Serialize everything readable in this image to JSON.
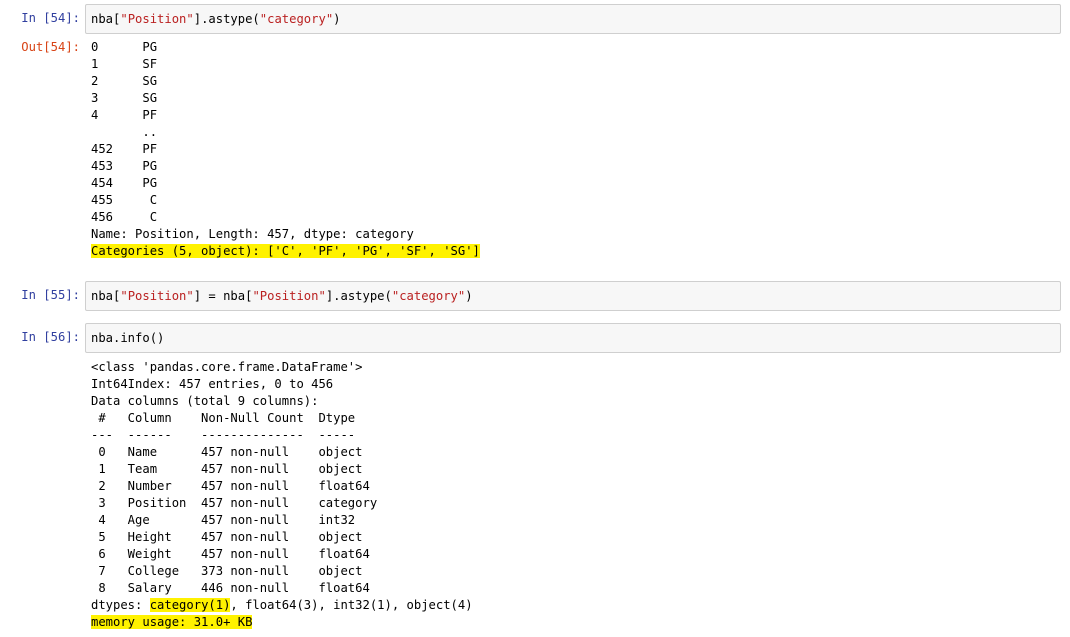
{
  "cells": [
    {
      "in_prompt": "In [54]:",
      "code": {
        "a": "nba[",
        "b": "\"Position\"",
        "c": "].astype(",
        "d": "\"category\"",
        "e": ")"
      },
      "out_prompt": "Out[54]:",
      "output_lines": [
        "0      PG",
        "1      SF",
        "2      SG",
        "3      SG",
        "4      PF",
        "       ..",
        "452    PF",
        "453    PG",
        "454    PG",
        "455     C",
        "456     C",
        "Name: Position, Length: 457, dtype: category",
        "Categories (5, object): ['C', 'PF', 'PG', 'SF', 'SG']"
      ]
    },
    {
      "in_prompt": "In [55]:",
      "code": {
        "a": "nba[",
        "b": "\"Position\"",
        "c": "] = nba[",
        "d": "\"Position\"",
        "e": "].astype(",
        "f": "\"category\"",
        "g": ")"
      }
    },
    {
      "in_prompt": "In [56]:",
      "code": {
        "a": "nba.info()"
      },
      "output_lines": [
        "<class 'pandas.core.frame.DataFrame'>",
        "Int64Index: 457 entries, 0 to 456",
        "Data columns (total 9 columns):",
        " #   Column    Non-Null Count  Dtype   ",
        "---  ------    --------------  -----   ",
        " 0   Name      457 non-null    object  ",
        " 1   Team      457 non-null    object  ",
        " 2   Number    457 non-null    float64 ",
        " 3   Position  457 non-null    category",
        " 4   Age       457 non-null    int32   ",
        " 5   Height    457 non-null    object  ",
        " 6   Weight    457 non-null    float64 ",
        " 7   College   373 non-null    object  ",
        " 8   Salary    446 non-null    float64 "
      ],
      "dtypes": {
        "prefix": "dtypes: ",
        "highlighted": "category(1)",
        "rest": ", float64(3), int32(1), object(4)"
      },
      "memory": "memory usage: 31.0+ KB"
    }
  ],
  "colors": {
    "in_prompt": "#303f9f",
    "out_prompt": "#d84315",
    "string": "#ba2121",
    "highlight": "#fff200",
    "input_bg": "#f7f7f7"
  }
}
